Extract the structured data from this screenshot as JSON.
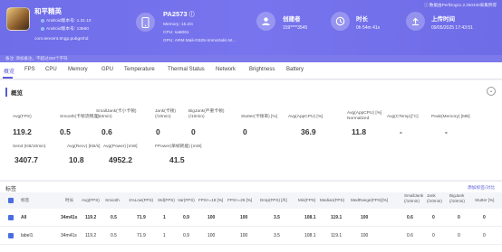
{
  "app": {
    "name": "和平精英",
    "android_version": "Android版本号: 1.31.10",
    "android_code": "Android版本号: 13560",
    "package": "com.tencent.tmgp.pubgmhd"
  },
  "device": {
    "model": "PA2573",
    "memory": "Memory: 15.2G",
    "cpu": "CPU: sa6061",
    "gpu": "GPU: ARM Mali-G925-Immortalis M..."
  },
  "creator": {
    "label": "创建者",
    "value": "159****3545"
  },
  "duration": {
    "label": "时长",
    "value": "0h 54m 41s"
  },
  "upload": {
    "label": "上传时间",
    "value": "09/05/2025 17:43:51"
  },
  "header_note": "数据由PerfDog11.2.250430采集所得",
  "notice": "备注: 添加备注，不超过250个字符",
  "tabs": [
    "概览",
    "FPS",
    "CPU",
    "Memory",
    "GPU",
    "Temperature",
    "Thermal Status",
    "Network",
    "Brightness",
    "Battery"
  ],
  "overview": {
    "title": "概览",
    "metrics_row1": [
      {
        "label": "Avg(FPS)",
        "value": "119.2"
      },
      {
        "label": "Smooth(卡顿流畅度)",
        "value": "0.5"
      },
      {
        "label": "SmallJank(卡小卡顿) (/10min)",
        "value": "0.6"
      },
      {
        "label": "Jank(卡顿) (/10min)",
        "value": "0"
      },
      {
        "label": "BigJank(严重卡顿) (/10min)",
        "value": "0"
      },
      {
        "label": "Stutter(卡顿率) [%]",
        "value": "0"
      },
      {
        "label": "Avg(AppCPU) [%]",
        "value": "36.9"
      },
      {
        "label": "Avg(AppCPU) [%] Normalized",
        "value": "11.8"
      },
      {
        "label": "Avg(CTemp)[°C]",
        "value": "-"
      },
      {
        "label": "Peak(Memory) [MB]",
        "value": "-"
      }
    ],
    "metrics_row2": [
      {
        "label": "Send (KB/10min)",
        "value": "3407.7"
      },
      {
        "label": "Avg(Recv) [KB/s]",
        "value": "10.8"
      },
      {
        "label": "Avg(Power) [mW]",
        "value": "4952.2"
      },
      {
        "label": "FPower(单帧耗能) [mW]",
        "value": "41.5"
      }
    ]
  },
  "section": {
    "title": "标签",
    "link": "添加标签/对比",
    "columns": [
      "标签",
      "时长",
      "Avg(FPS)",
      "Smooth",
      "1%Low(FPS)",
      "Std(FPS)",
      "Var(FPS)",
      "FPS>=18 [%]",
      "FPS>=25 [%]",
      "Drop(FPS) [/h]",
      "Min(FPS)",
      "Median(FPS)",
      "MedRange(FPS)[%]",
      "SmallJank (/10min)",
      "Jank (/10min)",
      "BigJank (/10min)",
      "Stutter [%]"
    ],
    "rows": [
      {
        "cells": [
          "All",
          "34m41s",
          "119.2",
          "0.5",
          "71.9",
          "1",
          "0.9",
          "100",
          "100",
          "3.5",
          "108.1",
          "119.1",
          "100",
          "0.6",
          "0",
          "0",
          "0"
        ]
      },
      {
        "cells": [
          "label1",
          "34m41s",
          "119.2",
          "0.5",
          "71.9",
          "1",
          "0.9",
          "100",
          "100",
          "3.5",
          "108.1",
          "119.1",
          "100",
          "0.6",
          "0",
          "0",
          "0"
        ]
      }
    ]
  },
  "colors": {
    "accent": "#5c5ad6",
    "header_bg": "#7774ee",
    "checkbox": "#4a6ee0"
  }
}
